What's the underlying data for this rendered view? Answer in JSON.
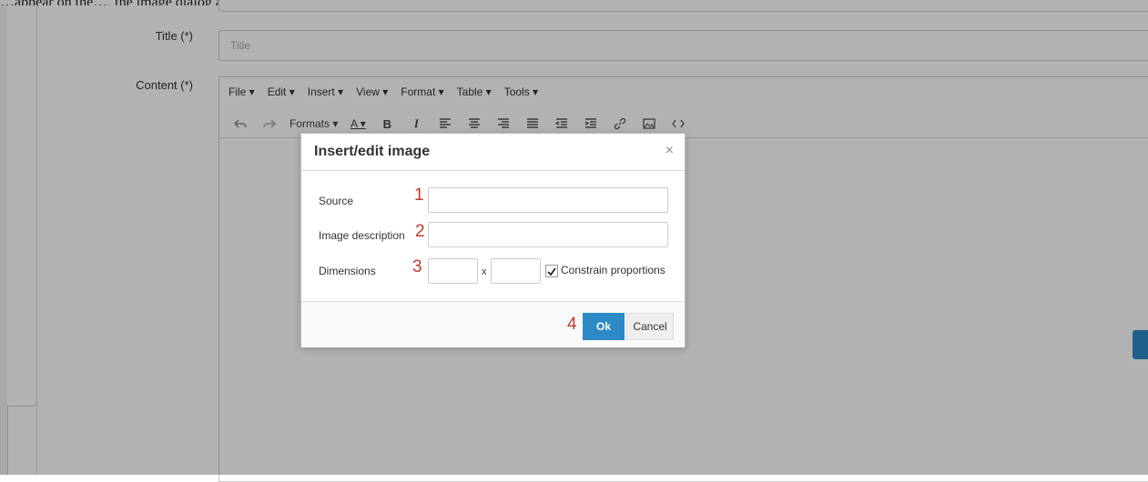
{
  "caption": "…appear on the…, the image dialog appears, …",
  "form": {
    "title_label": "Title (*)",
    "title_placeholder": "Title",
    "content_label": "Content (*)"
  },
  "editor": {
    "menu": [
      "File ▾",
      "Edit ▾",
      "Insert ▾",
      "View ▾",
      "Format ▾",
      "Table ▾",
      "Tools ▾"
    ],
    "toolbar": {
      "formats": "Formats ▾",
      "font_color": "A ▾",
      "bold": "B",
      "italic": "I"
    }
  },
  "modal": {
    "title": "Insert/edit image",
    "close": "×",
    "source_label": "Source",
    "description_label": "Image description",
    "dimensions_label": "Dimensions",
    "dimensions_sep": "x",
    "constrain_label": "Constrain proportions",
    "constrain_checked": true,
    "ok_label": "Ok",
    "cancel_label": "Cancel",
    "annotations": [
      "1",
      "2",
      "3",
      "4"
    ]
  },
  "colors": {
    "accent": "#2d8ac7",
    "annotation": "#c0392b"
  }
}
